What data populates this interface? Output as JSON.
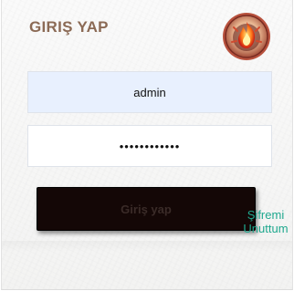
{
  "header": {
    "title": "GIRIŞ YAP"
  },
  "emblem": {
    "icon": "fire-emblem-icon"
  },
  "form": {
    "username_value": "admin",
    "password_value": "••••••••••••",
    "submit_label": "Giriş yap",
    "forgot_line1": "Şifremi",
    "forgot_line2": "Unuttum"
  },
  "colors": {
    "title": "#8b6a55",
    "button_bg": "#140706",
    "link": "#1fa88e",
    "autofill_bg": "#e8f0fe"
  }
}
